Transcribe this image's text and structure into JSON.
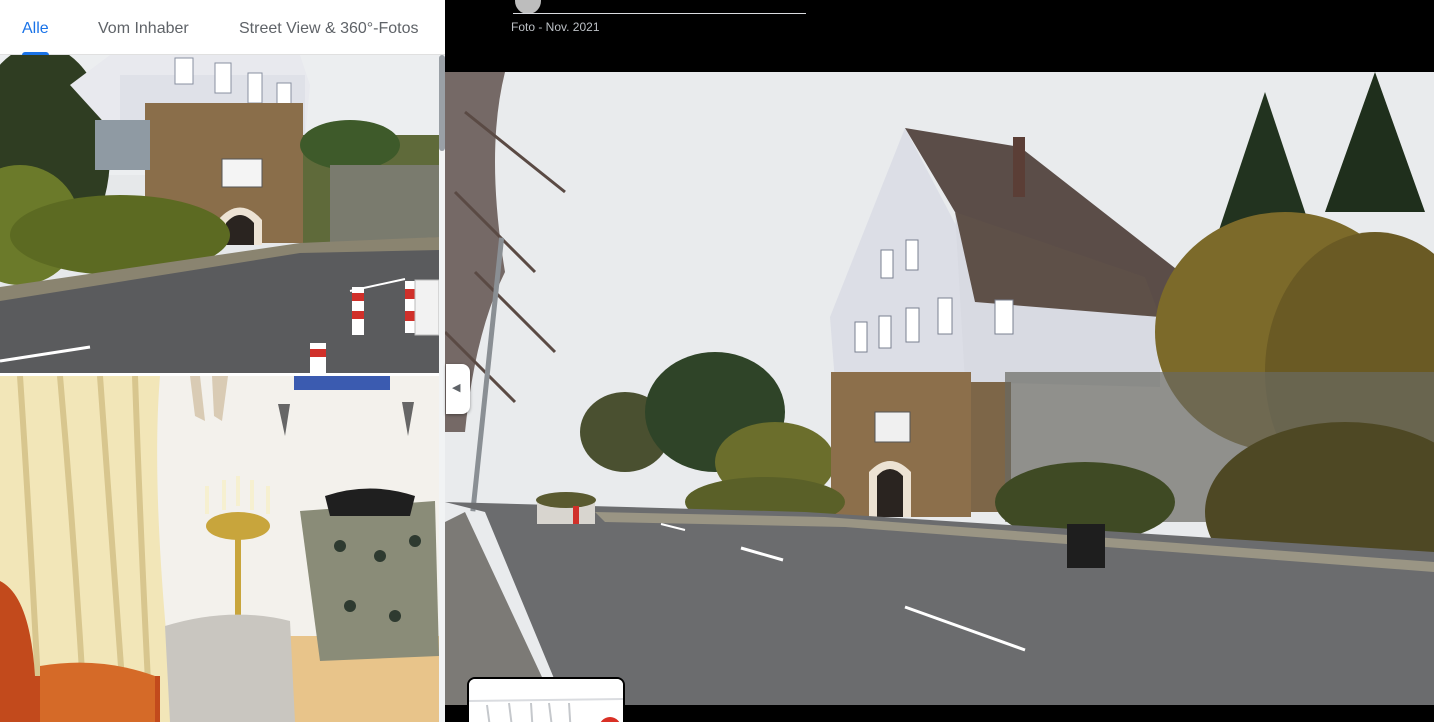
{
  "tabs": [
    {
      "label": "Alle",
      "active": true
    },
    {
      "label": "Vom Inhaber",
      "active": false
    },
    {
      "label": "Street View & 360°-Fotos",
      "active": false
    }
  ],
  "viewer": {
    "photo_date": "Foto - Nov. 2021"
  },
  "gallery": {
    "thumbnails": [
      {
        "subject": "building-street-thumbnail"
      },
      {
        "subject": "interior-candelabra-thumbnail"
      }
    ]
  },
  "colors": {
    "accent": "#1a73e8",
    "tab_inactive": "#5f6368",
    "viewer_bg": "#000000",
    "map_pin": "#d93025"
  },
  "icons": {
    "collapse": "chevron-left-icon",
    "pin": "map-pin-icon"
  }
}
